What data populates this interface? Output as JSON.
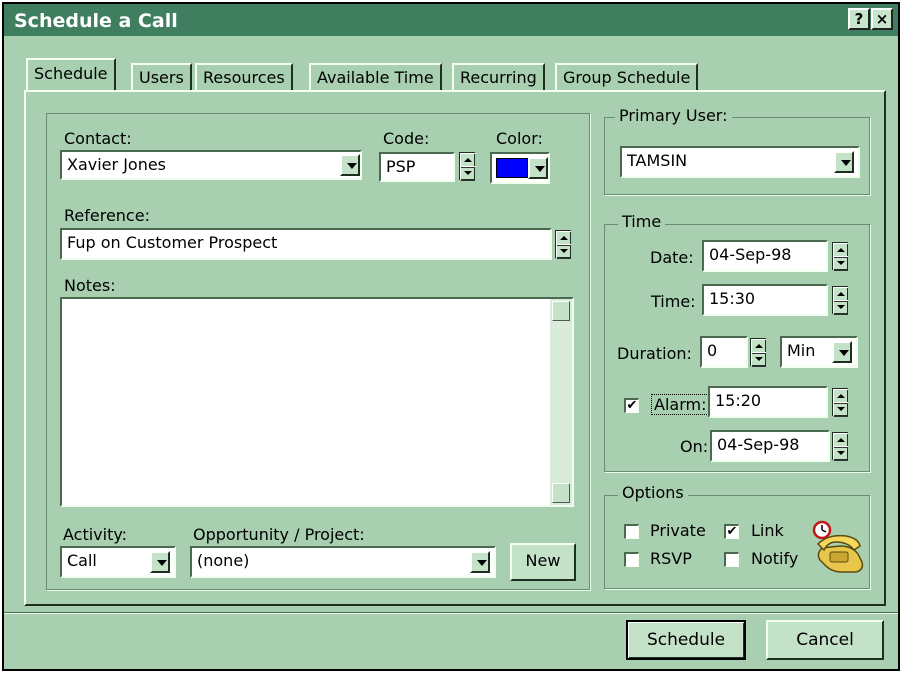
{
  "window": {
    "title": "Schedule a Call",
    "help_label": "?",
    "close_label": "×"
  },
  "tabs": [
    {
      "label": "Schedule",
      "active": true
    },
    {
      "label": "Users"
    },
    {
      "label": "Resources"
    },
    {
      "label": "Available Time"
    },
    {
      "label": "Recurring"
    },
    {
      "label": "Group Schedule"
    }
  ],
  "contact": {
    "label": "Contact:",
    "value": "Xavier Jones"
  },
  "code": {
    "label": "Code:",
    "value": "PSP"
  },
  "color": {
    "label": "Color:",
    "swatch": "#0000ff"
  },
  "reference": {
    "label": "Reference:",
    "value": "Fup on Customer Prospect"
  },
  "notes": {
    "label": "Notes:",
    "value": ""
  },
  "activity": {
    "label": "Activity:",
    "value": "Call"
  },
  "opportunity": {
    "label": "Opportunity / Project:",
    "value": "(none)"
  },
  "new_button": "New",
  "primary_user": {
    "legend": "Primary User:",
    "value": "TAMSIN"
  },
  "time_group": {
    "legend": "Time",
    "date_label": "Date:",
    "date_value": "04-Sep-98",
    "time_label": "Time:",
    "time_value": "15:30",
    "duration_label": "Duration:",
    "duration_value": "0",
    "duration_unit": "Min",
    "alarm_label": "Alarm:",
    "alarm_checked": true,
    "alarm_value": "15:20",
    "on_label": "On:",
    "on_value": "04-Sep-98"
  },
  "options": {
    "legend": "Options",
    "private_label": "Private",
    "private_checked": false,
    "link_label": "Link",
    "link_checked": true,
    "rsvp_label": "RSVP",
    "rsvp_checked": false,
    "notify_label": "Notify",
    "notify_checked": false
  },
  "footer": {
    "schedule_button": "Schedule",
    "cancel_button": "Cancel"
  }
}
